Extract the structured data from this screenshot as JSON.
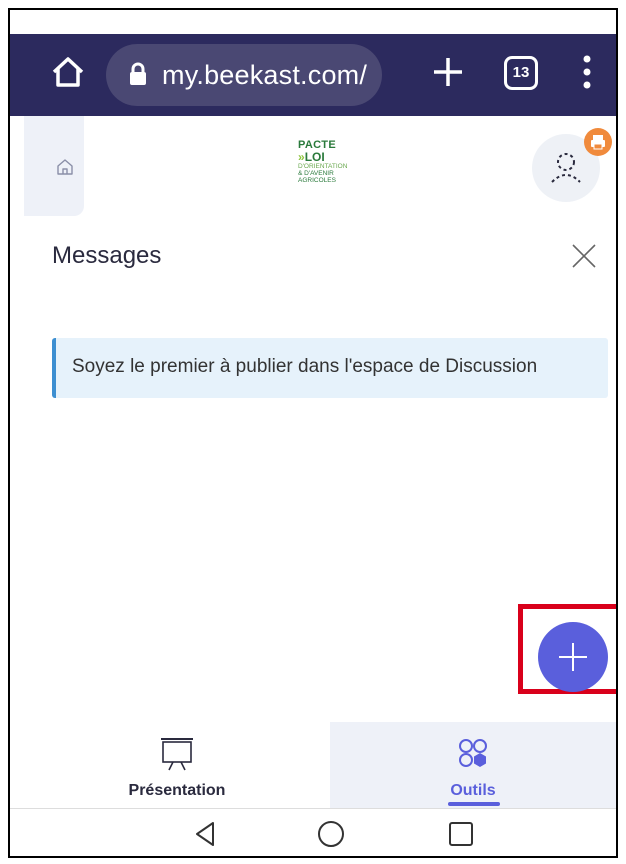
{
  "browser": {
    "url": "my.beekast.com/",
    "tab_count": "13",
    "icons": [
      "home-icon",
      "lock-icon",
      "plus-icon",
      "tabs-icon",
      "more-vert-icon"
    ]
  },
  "header": {
    "logo": {
      "line1": "PACTE",
      "line2": "LOI",
      "line3": "D'ORIENTATION",
      "line4": "& D'AVENIR",
      "line5": "AGRICOLES"
    }
  },
  "messages": {
    "title": "Messages",
    "notice": "Soyez le premier à publier dans l'espace de Discussion"
  },
  "bottom_nav": {
    "items": [
      {
        "label": "Présentation",
        "icon": "presentation-icon",
        "active": false
      },
      {
        "label": "Outils",
        "icon": "tools-icon",
        "active": true
      }
    ]
  },
  "colors": {
    "browser_bar": "#2c2a5e",
    "accent": "#5a5fdc",
    "notice_bg": "#e6f2fb",
    "notice_border": "#3d8fd1",
    "highlight": "#d9001b",
    "badge": "#f08a3c"
  }
}
